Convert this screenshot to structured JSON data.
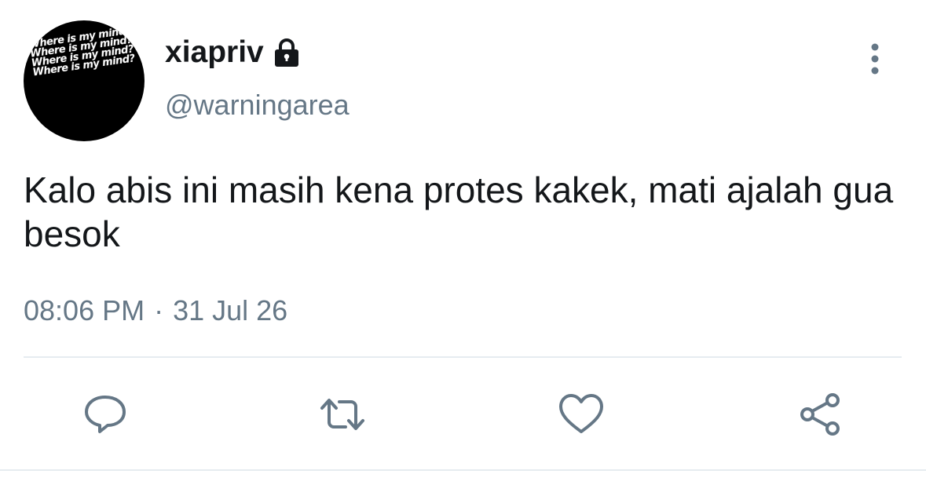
{
  "profile": {
    "display_name": "xiapriv",
    "handle": "@warningarea",
    "avatar_text": [
      "Where is my mind?",
      "Where is my mind?",
      "Where is my mind?",
      "Where is my mind?"
    ],
    "protected_icon": "lock-icon"
  },
  "tweet": {
    "text": "Kalo abis ini masih kena protes kakek, mati ajalah gua besok",
    "time": "08:06 PM",
    "separator": "·",
    "date": "31 Jul 26"
  },
  "actions": [
    {
      "icon": "reply-icon"
    },
    {
      "icon": "retweet-icon"
    },
    {
      "icon": "like-icon"
    },
    {
      "icon": "share-icon"
    }
  ],
  "colors": {
    "text": "#14171a",
    "secondary": "#657786",
    "icon": "#657786",
    "divider": "#e6ecf0",
    "background": "#ffffff"
  }
}
